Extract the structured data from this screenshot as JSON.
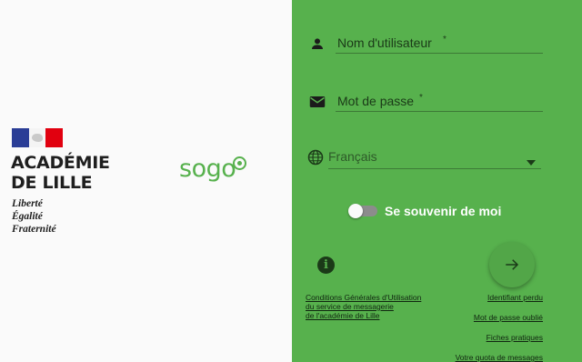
{
  "branding": {
    "academie_lines": [
      "ACADÉMIE",
      "DE LILLE"
    ],
    "motto_lines": [
      "Liberté",
      "Égalité",
      "Fraternité"
    ],
    "app_logo": "sogo",
    "accent_color": "#57b14d"
  },
  "form": {
    "username_label": "Nom d'utilisateur",
    "password_label": "Mot de passe",
    "required_marker": "*",
    "language_value": "Français",
    "remember_label": "Se souvenir de moi",
    "remember_on": false
  },
  "links": {
    "cgu": [
      "Conditions Générales d'Utilisation",
      "du service de messagerie",
      "de l'académie de Lille"
    ],
    "lost_id": "Identifiant perdu",
    "forgot_password": "Mot de passe oublié",
    "help_sheets": "Fiches pratiques",
    "quota": "Votre quota de messages"
  },
  "icons": {
    "user": "person-icon",
    "password": "mail-icon",
    "language": "globe-icon",
    "dropdown": "caret-down-icon",
    "info": "info-icon",
    "submit": "arrow-right-icon"
  }
}
